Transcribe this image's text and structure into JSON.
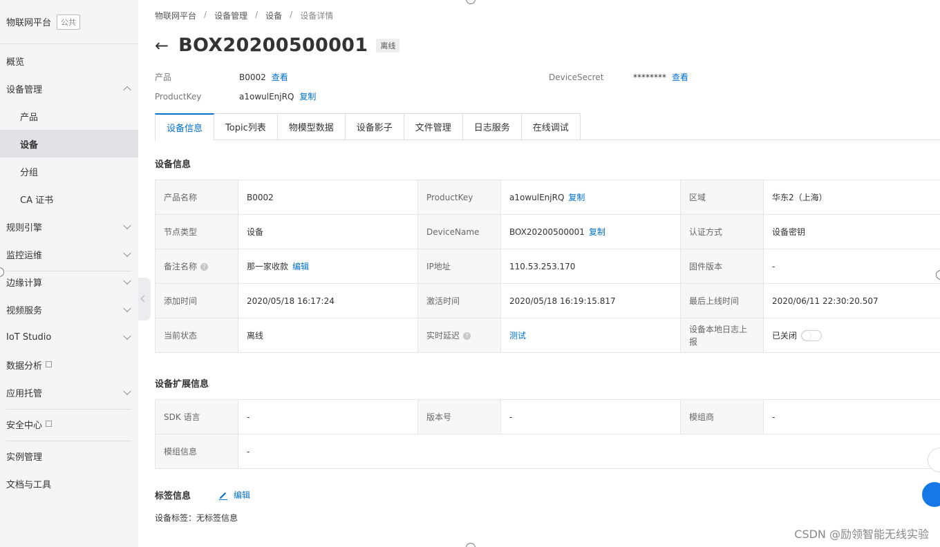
{
  "sidebar": {
    "brand_title": "物联网平台",
    "brand_badge": "公共",
    "items": [
      {
        "label": "概览"
      },
      {
        "label": "设备管理"
      },
      {
        "label": "产品"
      },
      {
        "label": "设备"
      },
      {
        "label": "分组"
      },
      {
        "label": "CA 证书"
      },
      {
        "label": "规则引擎"
      },
      {
        "label": "监控运维"
      },
      {
        "label": "边缘计算"
      },
      {
        "label": "视频服务"
      },
      {
        "label": "IoT Studio"
      },
      {
        "label": "数据分析"
      },
      {
        "label": "应用托管"
      },
      {
        "label": "安全中心"
      },
      {
        "label": "实例管理"
      },
      {
        "label": "文档与工具"
      }
    ]
  },
  "breadcrumb": [
    "物联网平台",
    "设备管理",
    "设备",
    "设备详情"
  ],
  "breadcrumb_sep": "/",
  "header": {
    "back_icon": "←",
    "title": "BOX20200500001",
    "status": "离线"
  },
  "meta": {
    "product_label": "产品",
    "product_value": "B0002",
    "product_link": "查看",
    "productkey_label": "ProductKey",
    "productkey_value": "a1owulEnjRQ",
    "productkey_link": "复制",
    "secret_label": "DeviceSecret",
    "secret_value": "********",
    "secret_link": "查看"
  },
  "tabs": [
    "设备信息",
    "Topic列表",
    "物模型数据",
    "设备影子",
    "文件管理",
    "日志服务",
    "在线调试"
  ],
  "device_info": {
    "title": "设备信息",
    "rows": [
      [
        {
          "k": "产品名称",
          "v": "B0002"
        },
        {
          "k": "ProductKey",
          "v": "a1owulEnjRQ",
          "link": "复制"
        },
        {
          "k": "区域",
          "v": "华东2（上海）"
        }
      ],
      [
        {
          "k": "节点类型",
          "v": "设备"
        },
        {
          "k": "DeviceName",
          "v": "BOX20200500001",
          "link": "复制"
        },
        {
          "k": "认证方式",
          "v": "设备密钥"
        }
      ],
      [
        {
          "k": "备注名称",
          "v": "那一家收款",
          "link": "编辑",
          "help": "?"
        },
        {
          "k": "IP地址",
          "v": "110.53.253.170"
        },
        {
          "k": "固件版本",
          "v": "-"
        }
      ],
      [
        {
          "k": "添加时间",
          "v": "2020/05/18 16:17:24"
        },
        {
          "k": "激活时间",
          "v": "2020/05/18 16:19:15.817"
        },
        {
          "k": "最后上线时间",
          "v": "2020/06/11 22:30:20.507"
        }
      ],
      [
        {
          "k": "当前状态",
          "v": "离线"
        },
        {
          "k": "实时延迟",
          "v": "测试",
          "help": "?",
          "vlink": true
        },
        {
          "k": "设备本地日志上报",
          "v": "已关闭",
          "toggle": true
        }
      ]
    ]
  },
  "ext_info": {
    "title": "设备扩展信息",
    "rows": [
      [
        {
          "k": "SDK 语言",
          "v": "-"
        },
        {
          "k": "版本号",
          "v": "-"
        },
        {
          "k": "模组商",
          "v": "-"
        }
      ],
      [
        {
          "k": "模组信息",
          "v": "-"
        }
      ]
    ]
  },
  "tag_info": {
    "title": "标签信息",
    "edit_label": "编辑",
    "line_label": "设备标签：",
    "line_value": "无标签信息"
  },
  "watermark": "CSDN @励领智能无线实验",
  "colors": {
    "accent": "#0070cc",
    "sidebar_bg": "#f5f5f6",
    "active_item": "#e2e2e4"
  },
  "icons": [
    "back-arrow-icon",
    "chevron-icon",
    "external-link-icon",
    "help-icon",
    "pencil-icon"
  ]
}
